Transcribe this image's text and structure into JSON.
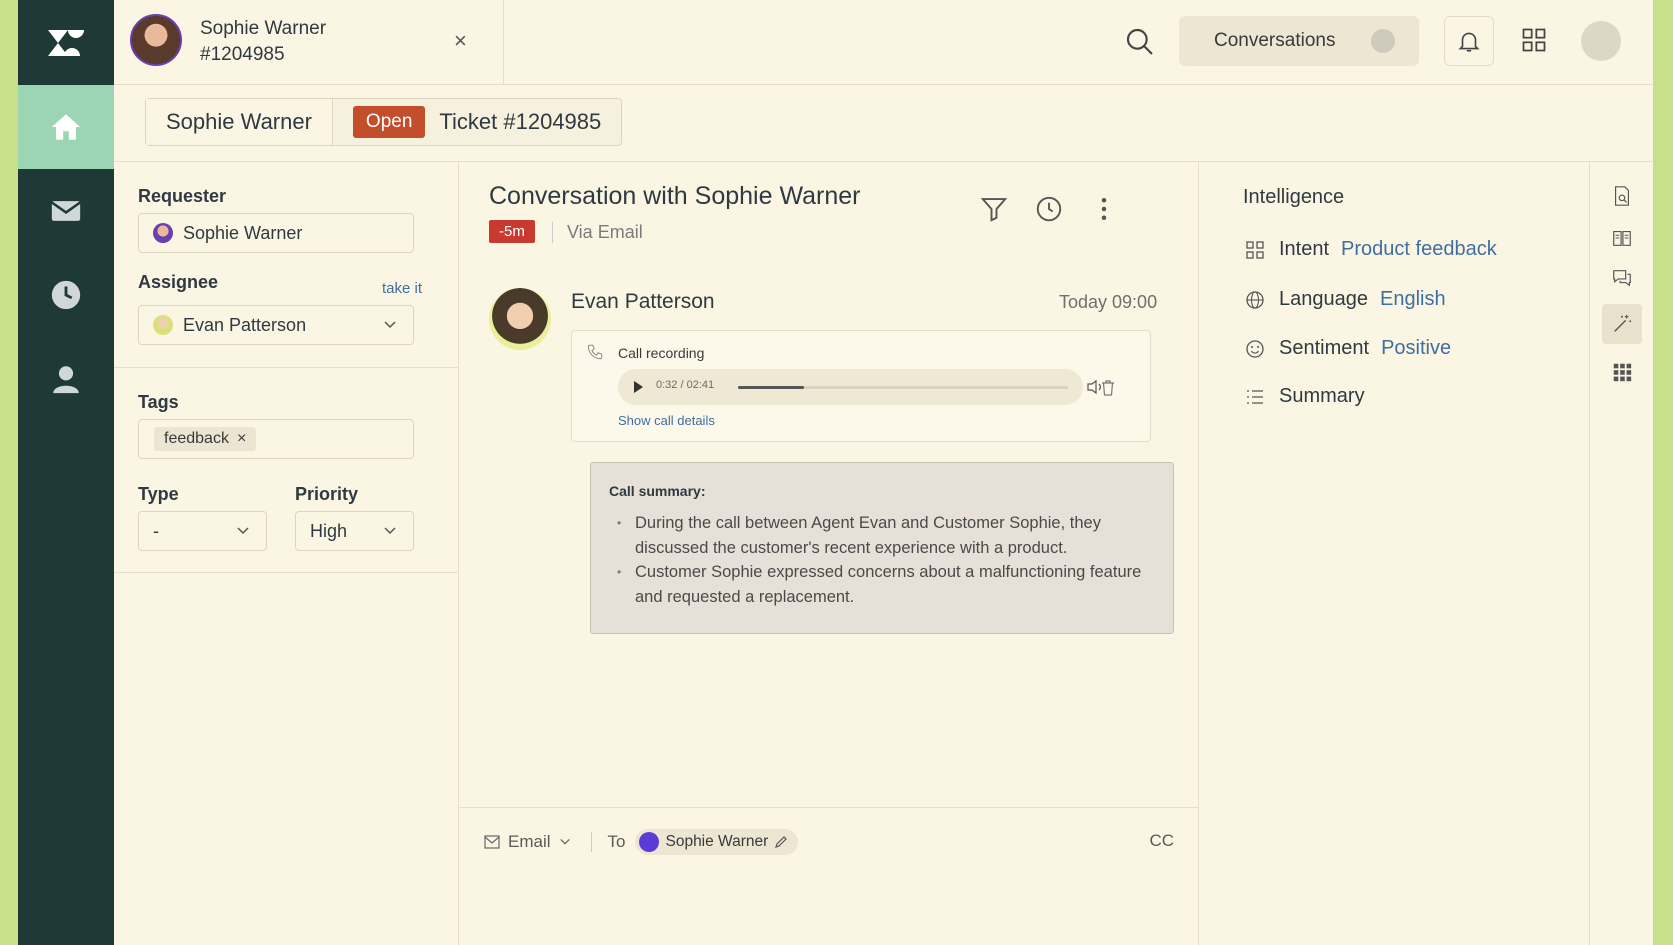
{
  "top_tab": {
    "name": "Sophie Warner",
    "id": "#1204985",
    "close": "×"
  },
  "topbar": {
    "conversations_label": "Conversations"
  },
  "breadcrumb": {
    "requester": "Sophie Warner",
    "status": "Open",
    "ticket": "Ticket #1204985"
  },
  "properties": {
    "requester_label": "Requester",
    "requester_value": "Sophie Warner",
    "assignee_label": "Assignee",
    "take_it": "take it",
    "assignee_value": "Evan Patterson",
    "tags_label": "Tags",
    "tags": [
      "feedback"
    ],
    "type_label": "Type",
    "type_value": "-",
    "priority_label": "Priority",
    "priority_value": "High"
  },
  "conversation": {
    "title": "Conversation with Sophie Warner",
    "time_badge": "-5m",
    "channel": "Via Email",
    "message": {
      "author": "Evan Patterson",
      "time": "Today 09:00",
      "call_label": "Call recording",
      "player_time": "0:32 / 02:41",
      "progress": 0.2,
      "details_link": "Show call details",
      "summary_title": "Call summary:",
      "summary_points": [
        "During the call between Agent Evan and Customer Sophie, they discussed the customer's recent experience with a product.",
        "Customer Sophie expressed concerns about a malfunctioning feature and requested a replacement."
      ]
    },
    "composer": {
      "channel": "Email",
      "to_label": "To",
      "recipient": "Sophie Warner",
      "cc": "CC"
    }
  },
  "intelligence": {
    "title": "Intelligence",
    "intent_label": "Intent",
    "intent_value": "Product feedback",
    "language_label": "Language",
    "language_value": "English",
    "sentiment_label": "Sentiment",
    "sentiment_value": "Positive",
    "summary_label": "Summary"
  },
  "colors": {
    "nav_bg": "#1f3936",
    "nav_active": "#9bd5b4",
    "open_badge": "#c24e2b",
    "link": "#3f6ea0",
    "page_bg": "#fbf6e4"
  }
}
